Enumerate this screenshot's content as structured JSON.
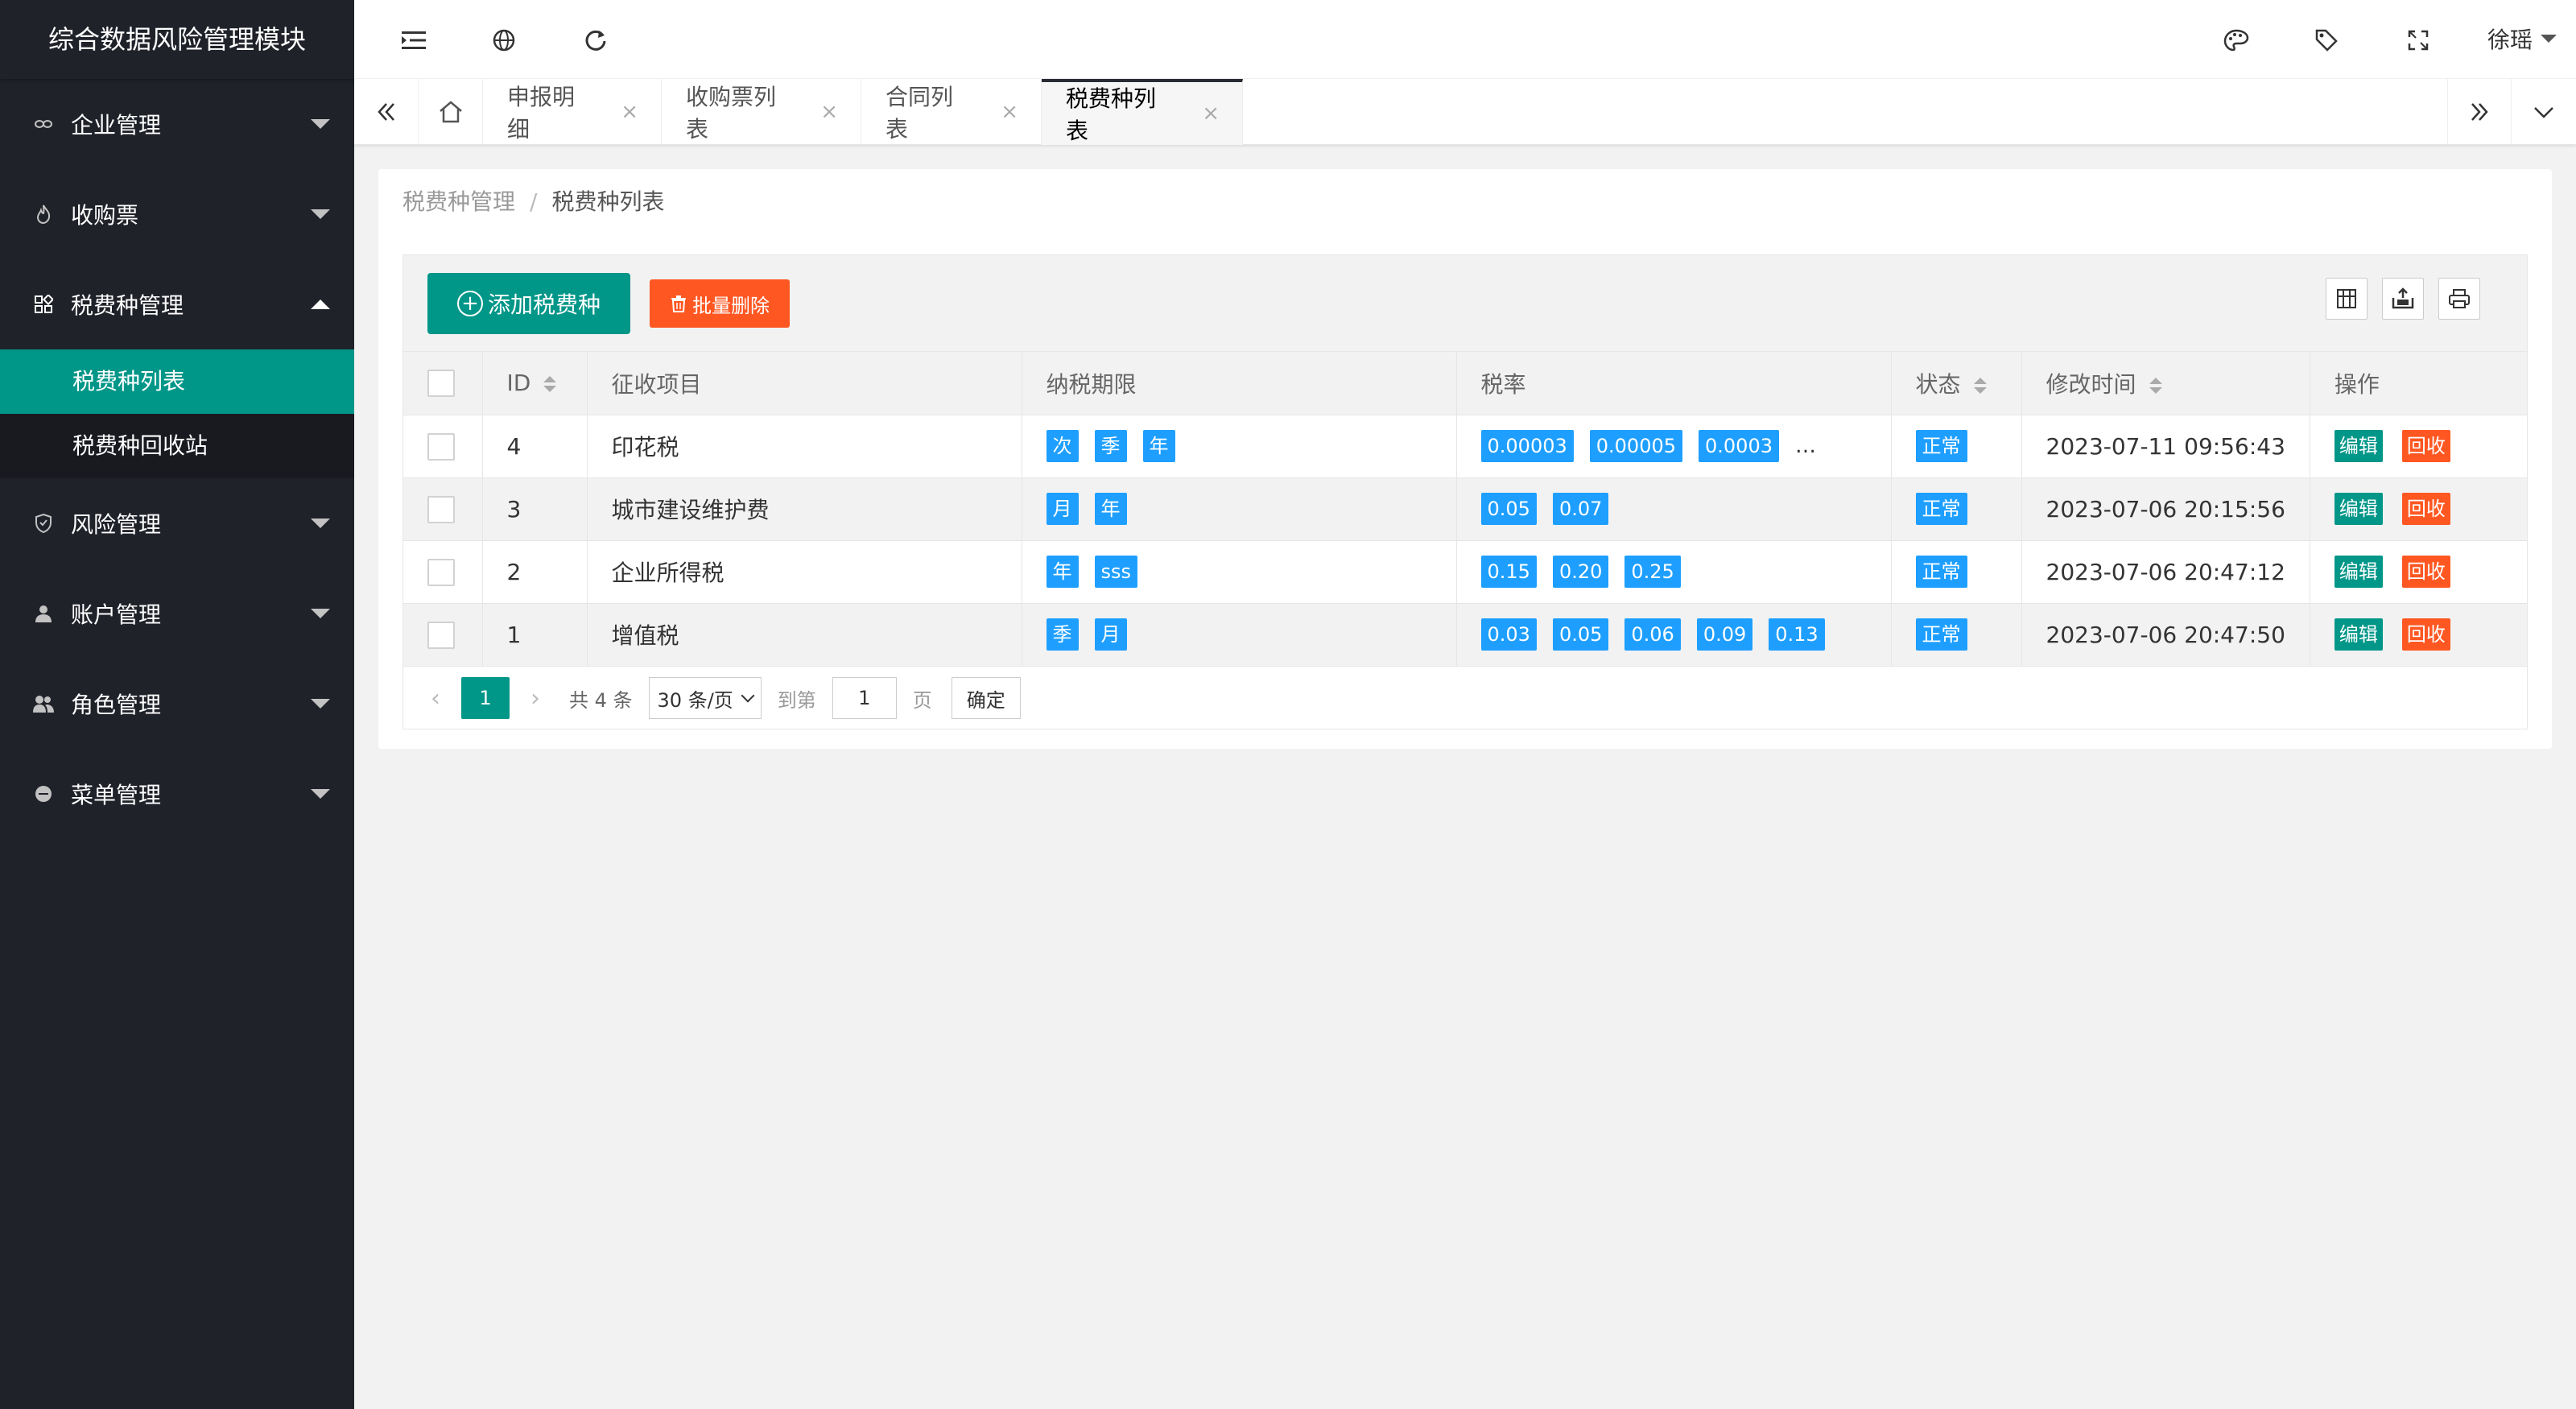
{
  "app": {
    "title": "综合数据风险管理模块"
  },
  "sidebar": {
    "items": [
      {
        "label": "企业管理",
        "icon": "link-icon"
      },
      {
        "label": "收购票",
        "icon": "flame-icon"
      },
      {
        "label": "税费种管理",
        "icon": "apps-icon",
        "expanded": true,
        "children": [
          {
            "label": "税费种列表",
            "active": true
          },
          {
            "label": "税费种回收站"
          }
        ]
      },
      {
        "label": "风险管理",
        "icon": "shield-icon"
      },
      {
        "label": "账户管理",
        "icon": "user-icon"
      },
      {
        "label": "角色管理",
        "icon": "users-icon"
      },
      {
        "label": "菜单管理",
        "icon": "circle-icon"
      }
    ]
  },
  "header": {
    "user": "徐瑶"
  },
  "tabs": [
    {
      "label": "申报明细"
    },
    {
      "label": "收购票列表"
    },
    {
      "label": "合同列表"
    },
    {
      "label": "税费种列表",
      "active": true
    }
  ],
  "tab_close": "×",
  "breadcrumb": {
    "parent": "税费种管理",
    "separator": "/",
    "current": "税费种列表"
  },
  "toolbar": {
    "add_label": "添加税费种",
    "batch_delete_label": "批量删除"
  },
  "table": {
    "columns": [
      "ID",
      "征收项目",
      "纳税期限",
      "税率",
      "状态",
      "修改时间",
      "操作"
    ],
    "rows": [
      {
        "id": "4",
        "item": "印花税",
        "periods": [
          "次",
          "季",
          "年"
        ],
        "rates": [
          "0.00003",
          "0.00005",
          "0.0003"
        ],
        "rates_more": "…",
        "status": "正常",
        "modified": "2023-07-11 09:56:43"
      },
      {
        "id": "3",
        "item": "城市建设维护费",
        "periods": [
          "月",
          "年"
        ],
        "rates": [
          "0.05",
          "0.07"
        ],
        "rates_more": "",
        "status": "正常",
        "modified": "2023-07-06 20:15:56"
      },
      {
        "id": "2",
        "item": "企业所得税",
        "periods": [
          "年",
          "sss"
        ],
        "rates": [
          "0.15",
          "0.20",
          "0.25"
        ],
        "rates_more": "",
        "status": "正常",
        "modified": "2023-07-06 20:47:12"
      },
      {
        "id": "1",
        "item": "增值税",
        "periods": [
          "季",
          "月"
        ],
        "rates": [
          "0.03",
          "0.05",
          "0.06",
          "0.09",
          "0.13"
        ],
        "rates_more": "",
        "status": "正常",
        "modified": "2023-07-06 20:47:50"
      }
    ],
    "actions": {
      "edit": "编辑",
      "recycle": "回收"
    }
  },
  "pager": {
    "current": "1",
    "total": "共 4 条",
    "page_size": "30 条/页",
    "goto": "到第",
    "page_input": "1",
    "page_label": "页",
    "confirm": "确定"
  },
  "colors": {
    "sidebar_bg": "#20222a",
    "accent": "#009688",
    "danger": "#ff5722",
    "badge": "#1e9fff"
  }
}
